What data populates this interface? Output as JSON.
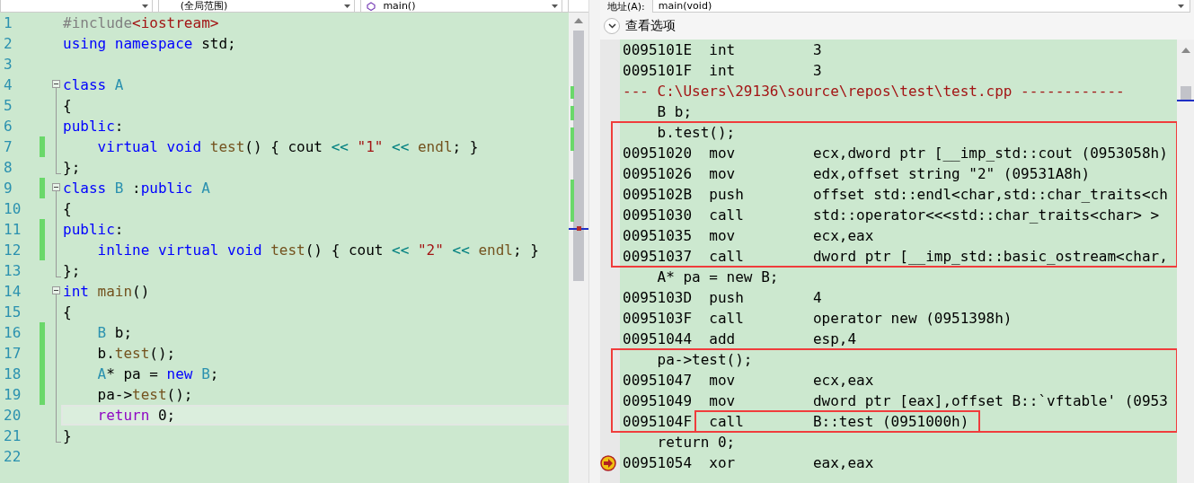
{
  "editor": {
    "toolbar": {
      "scope": "(全局范围)",
      "member": "main()"
    },
    "lines": [
      {
        "number": "1",
        "changed": false,
        "collapsible": false,
        "guide": false,
        "tokens": [
          {
            "kind": "pre",
            "text": "#include"
          },
          {
            "kind": "inc",
            "text": "<iostream>"
          }
        ]
      },
      {
        "number": "2",
        "changed": false,
        "collapsible": false,
        "guide": false,
        "tokens": [
          {
            "kind": "kw",
            "text": "using namespace"
          },
          {
            "kind": "plain",
            "text": " std;"
          }
        ]
      },
      {
        "number": "3",
        "changed": false,
        "collapsible": false,
        "guide": false
      },
      {
        "number": "4",
        "changed": false,
        "collapsible": true,
        "guide": false,
        "tokens": [
          {
            "kind": "kw",
            "text": "class"
          },
          {
            "kind": "type",
            "text": " A"
          }
        ]
      },
      {
        "number": "5",
        "changed": false,
        "collapsible": false,
        "guide": true,
        "tokens": [
          {
            "kind": "plain",
            "text": "{"
          }
        ]
      },
      {
        "number": "6",
        "changed": false,
        "collapsible": false,
        "guide": true,
        "tokens": [
          {
            "kind": "kw",
            "text": "public"
          },
          {
            "kind": "plain",
            "text": ":"
          }
        ]
      },
      {
        "number": "7",
        "changed": true,
        "collapsible": false,
        "guide": true,
        "tokens": [
          {
            "kind": "kw",
            "text": "    virtual void"
          },
          {
            "kind": "fn",
            "text": " test"
          },
          {
            "kind": "plain",
            "text": "() { cout"
          },
          {
            "kind": "op",
            "text": " <<"
          },
          {
            "kind": "str",
            "text": " \"1\""
          },
          {
            "kind": "op",
            "text": " <<"
          },
          {
            "kind": "fn",
            "text": " endl"
          },
          {
            "kind": "plain",
            "text": "; }"
          }
        ]
      },
      {
        "number": "8",
        "changed": false,
        "collapsible": false,
        "guide": true,
        "tokens": [
          {
            "kind": "plain",
            "text": "};"
          }
        ]
      },
      {
        "number": "9",
        "changed": true,
        "collapsible": true,
        "guide": false,
        "tokens": [
          {
            "kind": "kw",
            "text": "class"
          },
          {
            "kind": "type",
            "text": " B"
          },
          {
            "kind": "plain",
            "text": " :"
          },
          {
            "kind": "kw",
            "text": "public"
          },
          {
            "kind": "type",
            "text": " A"
          }
        ]
      },
      {
        "number": "10",
        "changed": false,
        "collapsible": false,
        "guide": true,
        "tokens": [
          {
            "kind": "plain",
            "text": "{"
          }
        ]
      },
      {
        "number": "11",
        "changed": true,
        "collapsible": false,
        "guide": true,
        "tokens": [
          {
            "kind": "kw",
            "text": "public"
          },
          {
            "kind": "plain",
            "text": ":"
          }
        ]
      },
      {
        "number": "12",
        "changed": true,
        "collapsible": false,
        "guide": true,
        "tokens": [
          {
            "kind": "kw",
            "text": "    inline virtual void"
          },
          {
            "kind": "fn",
            "text": " test"
          },
          {
            "kind": "plain",
            "text": "() { cout"
          },
          {
            "kind": "op",
            "text": " <<"
          },
          {
            "kind": "str",
            "text": " \"2\""
          },
          {
            "kind": "op",
            "text": " <<"
          },
          {
            "kind": "fn",
            "text": " endl"
          },
          {
            "kind": "plain",
            "text": "; }"
          }
        ]
      },
      {
        "number": "13",
        "changed": false,
        "collapsible": false,
        "guide": true,
        "tokens": [
          {
            "kind": "plain",
            "text": "};"
          }
        ]
      },
      {
        "number": "14",
        "changed": false,
        "collapsible": true,
        "guide": false,
        "tokens": [
          {
            "kind": "kw",
            "text": "int"
          },
          {
            "kind": "fn",
            "text": " main"
          },
          {
            "kind": "plain",
            "text": "()"
          }
        ]
      },
      {
        "number": "15",
        "changed": false,
        "collapsible": false,
        "guide": true,
        "tokens": [
          {
            "kind": "plain",
            "text": "{"
          }
        ]
      },
      {
        "number": "16",
        "changed": true,
        "collapsible": false,
        "guide": true,
        "tokens": [
          {
            "kind": "type",
            "text": "    B"
          },
          {
            "kind": "plain",
            "text": " b;"
          }
        ]
      },
      {
        "number": "17",
        "changed": true,
        "collapsible": false,
        "guide": true,
        "tokens": [
          {
            "kind": "plain",
            "text": "    b."
          },
          {
            "kind": "fn",
            "text": "test"
          },
          {
            "kind": "plain",
            "text": "();"
          }
        ]
      },
      {
        "number": "18",
        "changed": true,
        "collapsible": false,
        "guide": true,
        "tokens": [
          {
            "kind": "type",
            "text": "    A"
          },
          {
            "kind": "plain",
            "text": "* pa ="
          },
          {
            "kind": "kw",
            "text": " new"
          },
          {
            "kind": "type",
            "text": " B"
          },
          {
            "kind": "plain",
            "text": ";"
          }
        ]
      },
      {
        "number": "19",
        "changed": true,
        "collapsible": false,
        "guide": true,
        "tokens": [
          {
            "kind": "plain",
            "text": "    pa->"
          },
          {
            "kind": "fn",
            "text": "test"
          },
          {
            "kind": "plain",
            "text": "();"
          }
        ]
      },
      {
        "number": "20",
        "changed": false,
        "collapsible": false,
        "guide": true,
        "current": true,
        "tokens": [
          {
            "kind": "ctl",
            "text": "    return"
          },
          {
            "kind": "plain",
            "text": " 0;"
          }
        ]
      },
      {
        "number": "21",
        "changed": false,
        "collapsible": false,
        "guide": true,
        "tokens": [
          {
            "kind": "plain",
            "text": "}"
          }
        ]
      },
      {
        "number": "22",
        "changed": false,
        "collapsible": false,
        "guide": false
      }
    ]
  },
  "disassembly": {
    "address_label": "地址(A):",
    "address": "main(void)",
    "options_label": "查看选项",
    "blocks": [
      {
        "boxed": false,
        "rows": [
          {
            "kind": "asm",
            "address": "0095101E",
            "op": "int",
            "operand": "3"
          },
          {
            "kind": "asm",
            "address": "0095101F",
            "op": "int",
            "operand": "3"
          },
          {
            "kind": "file",
            "text": "--- C:\\Users\\29136\\source\\repos\\test\\test.cpp ------------"
          },
          {
            "kind": "source",
            "text": "    B b;"
          }
        ]
      },
      {
        "boxed": true,
        "rows": [
          {
            "kind": "source",
            "text": "    b.test();"
          },
          {
            "kind": "asm",
            "address": "00951020",
            "op": "mov",
            "operand": "ecx,dword ptr [__imp_std::cout (0953058h)"
          },
          {
            "kind": "asm",
            "address": "00951026",
            "op": "mov",
            "operand": "edx,offset string \"2\" (09531A8h)"
          },
          {
            "kind": "asm",
            "address": "0095102B",
            "op": "push",
            "operand": "offset std::endl<char,std::char_traits<ch"
          },
          {
            "kind": "asm",
            "address": "00951030",
            "op": "call",
            "operand": "std::operator<<<std::char_traits<char> >"
          },
          {
            "kind": "asm",
            "address": "00951035",
            "op": "mov",
            "operand": "ecx,eax"
          },
          {
            "kind": "asm",
            "address": "00951037",
            "op": "call",
            "operand": "dword ptr [__imp_std::basic_ostream<char,"
          }
        ]
      },
      {
        "boxed": false,
        "rows": [
          {
            "kind": "source",
            "text": "    A* pa = new B;"
          },
          {
            "kind": "asm",
            "address": "0095103D",
            "op": "push",
            "operand": "4"
          },
          {
            "kind": "asm",
            "address": "0095103F",
            "op": "call",
            "operand": "operator new (0951398h)"
          },
          {
            "kind": "asm",
            "address": "00951044",
            "op": "add",
            "operand": "esp,4"
          }
        ]
      },
      {
        "boxed": true,
        "rows": [
          {
            "kind": "source",
            "text": "    pa->test();"
          },
          {
            "kind": "asm",
            "address": "00951047",
            "op": "mov",
            "operand": "ecx,eax"
          },
          {
            "kind": "asm",
            "address": "00951049",
            "op": "mov",
            "operand": "dword ptr [eax],offset B::`vftable' (0953"
          },
          {
            "kind": "asm",
            "address": "0095104F",
            "op": "call",
            "operand": "B::test (0951000h)",
            "call_boxed": true
          }
        ]
      },
      {
        "boxed": false,
        "rows": [
          {
            "kind": "source",
            "text": "    return 0;"
          },
          {
            "kind": "asm",
            "address": "00951054",
            "op": "xor",
            "operand": "eax,eax",
            "current": true
          }
        ]
      }
    ]
  }
}
